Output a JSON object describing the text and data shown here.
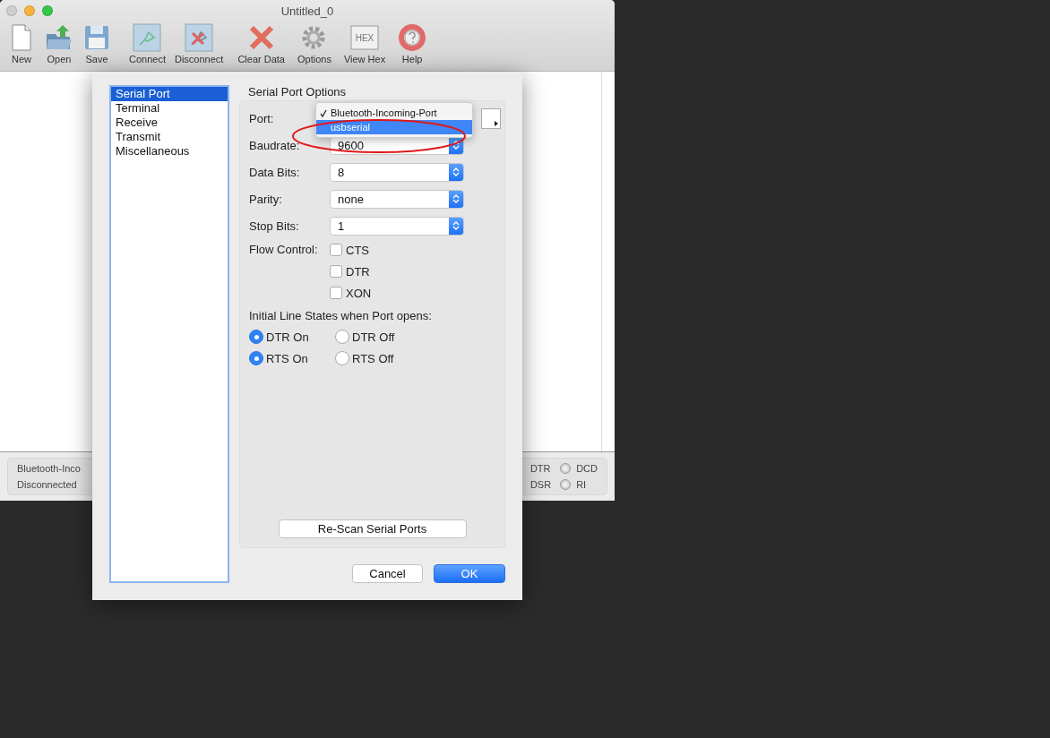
{
  "window": {
    "title": "Untitled_0"
  },
  "toolbar": [
    {
      "label": "New",
      "kind": "new"
    },
    {
      "label": "Open",
      "kind": "open"
    },
    {
      "label": "Save",
      "kind": "save"
    },
    {
      "label": "Connect",
      "kind": "connect"
    },
    {
      "label": "Disconnect",
      "kind": "disconnect"
    },
    {
      "label": "Clear Data",
      "kind": "clear"
    },
    {
      "label": "Options",
      "kind": "options"
    },
    {
      "label": "View Hex",
      "kind": "hex",
      "icon_text": "HEX"
    },
    {
      "label": "Help",
      "kind": "help"
    }
  ],
  "status_bar": {
    "port": "Bluetooth-Inco",
    "connection": "Disconnected",
    "signals": [
      {
        "label": "DTR"
      },
      {
        "label": "DSR"
      }
    ],
    "leds": [
      {
        "label": "DCD",
        "on": false
      },
      {
        "label": "RI",
        "on": false
      }
    ]
  },
  "dialog": {
    "categories": [
      {
        "label": "Serial Port",
        "selected": true
      },
      {
        "label": "Terminal",
        "selected": false
      },
      {
        "label": "Receive",
        "selected": false
      },
      {
        "label": "Transmit",
        "selected": false
      },
      {
        "label": "Miscellaneous",
        "selected": false
      }
    ],
    "section_title": "Serial Port Options",
    "port_label": "Port:",
    "port_menu": [
      {
        "label": "Bluetooth-Incoming-Port",
        "checked": true,
        "selected": false
      },
      {
        "label": "usbserial",
        "checked": false,
        "selected": true
      }
    ],
    "fields": [
      {
        "label": "Baudrate:",
        "value": "9600"
      },
      {
        "label": "Data Bits:",
        "value": "8"
      },
      {
        "label": "Parity:",
        "value": "none"
      },
      {
        "label": "Stop Bits:",
        "value": "1"
      }
    ],
    "flow_control_label": "Flow Control:",
    "flow_control": [
      {
        "label": "CTS",
        "checked": false
      },
      {
        "label": "DTR",
        "checked": false
      },
      {
        "label": "XON",
        "checked": false
      }
    ],
    "line_states_title": "Initial Line States when Port opens:",
    "line_states": [
      [
        {
          "label": "DTR On",
          "selected": true
        },
        {
          "label": "DTR Off",
          "selected": false
        }
      ],
      [
        {
          "label": "RTS On",
          "selected": true
        },
        {
          "label": "RTS Off",
          "selected": false
        }
      ]
    ],
    "rescan_button": "Re-Scan Serial Ports",
    "buttons": [
      {
        "label": "Cancel",
        "kind": "secondary"
      },
      {
        "label": "OK",
        "kind": "primary"
      }
    ]
  }
}
